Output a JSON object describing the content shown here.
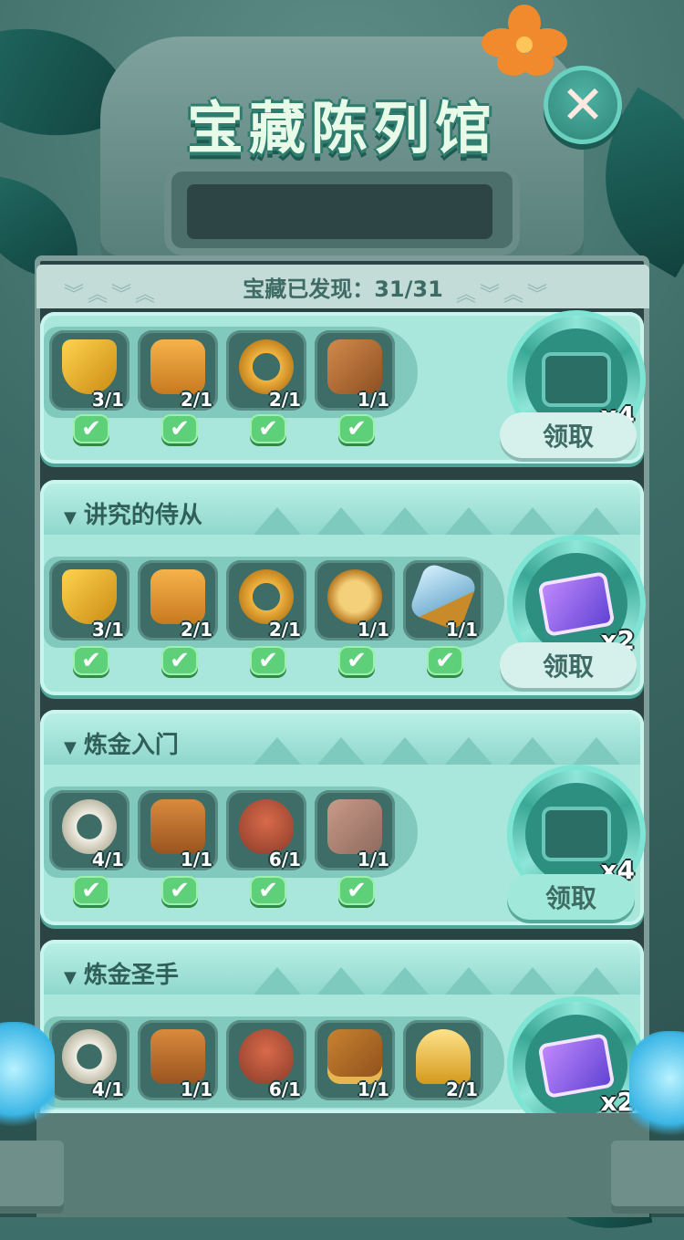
{
  "title": "宝藏陈列馆",
  "close_icon": "close-icon",
  "discovered": {
    "label": "宝藏已发现：31/31"
  },
  "colors": {
    "accent": "#4fb3a3",
    "check": "#5fd07a",
    "panel": "#a9e6dc"
  },
  "panels": [
    {
      "title": "",
      "items": [
        {
          "icon": "mickey-shield-icon",
          "count": "3/1",
          "checked": true
        },
        {
          "icon": "golden-armor-icon",
          "count": "2/1",
          "checked": true
        },
        {
          "icon": "golden-belt-icon",
          "count": "2/1",
          "checked": true
        },
        {
          "icon": "leather-bracers-icon",
          "count": "1/1",
          "checked": true
        }
      ],
      "reward": {
        "icon": "eye-card-icon",
        "qty": "x4"
      },
      "claim_label": "领取"
    },
    {
      "title": "讲究的侍从",
      "items": [
        {
          "icon": "mickey-shield-icon",
          "count": "3/1",
          "checked": true
        },
        {
          "icon": "golden-armor-icon",
          "count": "2/1",
          "checked": true
        },
        {
          "icon": "golden-belt-icon",
          "count": "2/1",
          "checked": true
        },
        {
          "icon": "mickey-medallion-icon",
          "count": "1/1",
          "checked": true
        },
        {
          "icon": "crystal-sword-icon",
          "count": "1/1",
          "checked": true
        }
      ],
      "reward": {
        "icon": "mickey-cards-icon",
        "qty": "x2"
      },
      "claim_label": "领取"
    },
    {
      "title": "炼金入门",
      "items": [
        {
          "icon": "bone-ring-icon",
          "count": "4/1",
          "checked": true
        },
        {
          "icon": "tiki-mask-icon",
          "count": "1/1",
          "checked": true
        },
        {
          "icon": "tribal-egg-icon",
          "count": "6/1",
          "checked": true
        },
        {
          "icon": "stone-tablet-icon",
          "count": "1/1",
          "checked": true
        }
      ],
      "reward": {
        "icon": "eye-card-icon",
        "qty": "x4"
      },
      "claim_label": "领取"
    },
    {
      "title": "炼金圣手",
      "items": [
        {
          "icon": "bone-ring-icon",
          "count": "4/1",
          "checked": false
        },
        {
          "icon": "tiki-mask-icon",
          "count": "1/1",
          "checked": false
        },
        {
          "icon": "tribal-egg-icon",
          "count": "6/1",
          "checked": false
        },
        {
          "icon": "wallet-book-icon",
          "count": "1/1",
          "checked": false
        },
        {
          "icon": "golden-trophy-icon",
          "count": "2/1",
          "checked": false
        }
      ],
      "reward": {
        "icon": "mickey-cards-icon",
        "qty": "x2"
      },
      "claim_label": ""
    }
  ],
  "check_glyph": "✔"
}
